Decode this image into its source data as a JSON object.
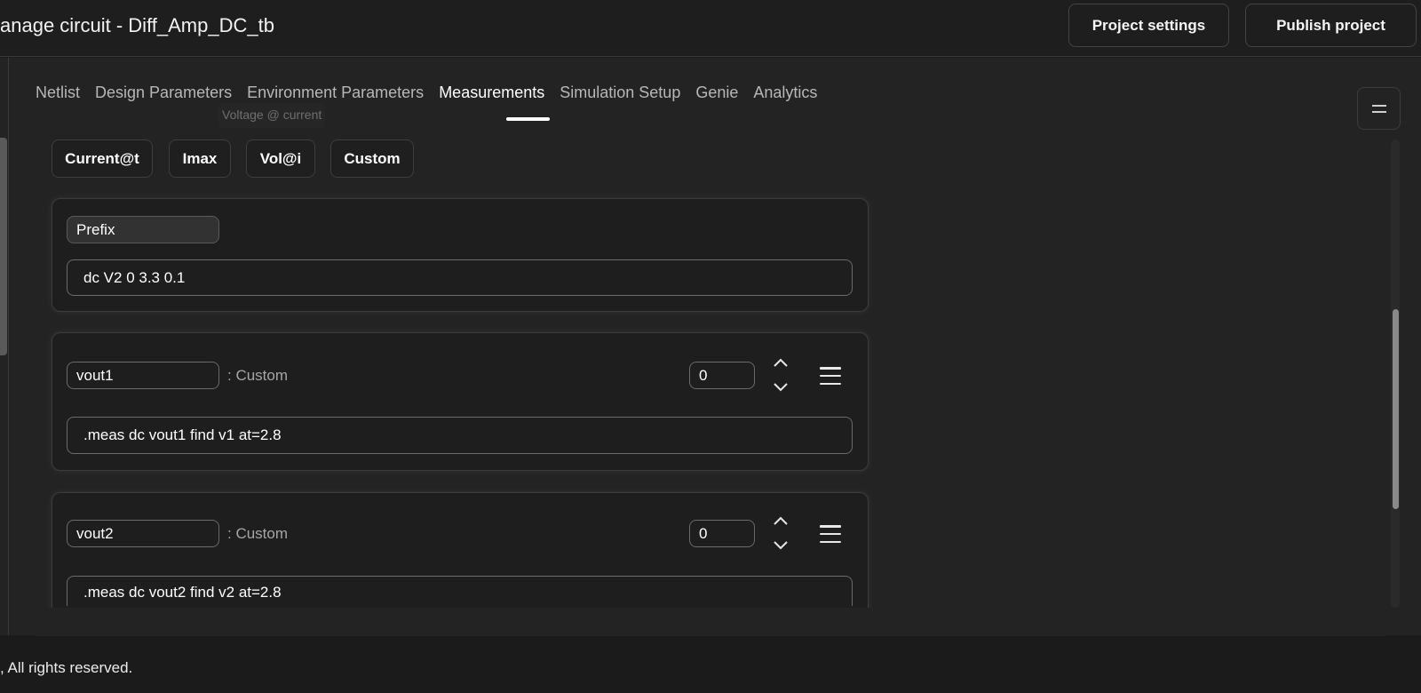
{
  "header": {
    "title": "anage circuit - Diff_Amp_DC_tb",
    "project_settings": "Project settings",
    "publish_project": "Publish project"
  },
  "tabs": [
    {
      "label": "Netlist",
      "active": false
    },
    {
      "label": "Design Parameters",
      "active": false
    },
    {
      "label": "Environment Parameters",
      "active": false
    },
    {
      "label": "Measurements",
      "active": true
    },
    {
      "label": "Simulation Setup",
      "active": false
    },
    {
      "label": "Genie",
      "active": false
    },
    {
      "label": "Analytics",
      "active": false
    }
  ],
  "tooltip": "Voltage @ current",
  "measure_types": [
    "Current@t",
    "Imax",
    "Vol@i",
    "Custom"
  ],
  "prefix_card": {
    "label": "Prefix",
    "value": "dc V2 0 3.3 0.1"
  },
  "measurements": [
    {
      "name": "vout1",
      "type": ": Custom",
      "order": "0",
      "command": ".meas dc vout1 find v1 at=2.8"
    },
    {
      "name": "vout2",
      "type": ": Custom",
      "order": "0",
      "command": ".meas dc vout2 find v2 at=2.8"
    }
  ],
  "footer": {
    "text": ", All rights reserved."
  },
  "colors": {
    "background": "#232323",
    "header_bg": "#1e1e1e",
    "accent": "#ffffff"
  }
}
